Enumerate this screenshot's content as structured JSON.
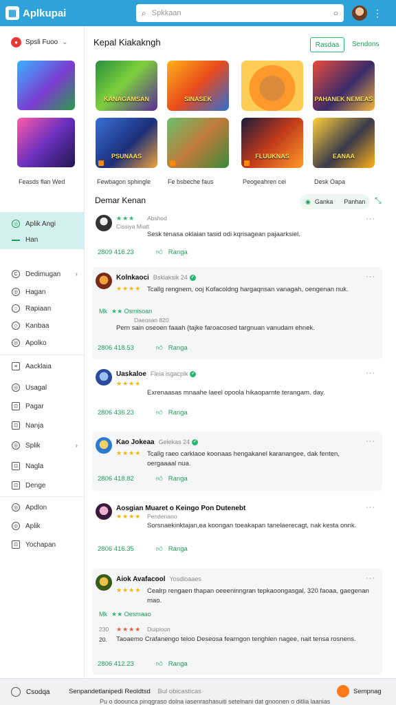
{
  "header": {
    "app_name": "Aplkupai",
    "search_placeholder": "Spkkaan"
  },
  "sidebar": {
    "profile_label": "Spsli Fuoo",
    "caption": "Feasds flan Wed",
    "active_title": "Aplik Angi",
    "active_sub": "Han",
    "items": [
      {
        "label": "Dedimugan",
        "icon": "C",
        "chevron": "›"
      },
      {
        "label": "Hagan",
        "icon": "◎"
      },
      {
        "label": "Rapiaan",
        "icon": "○"
      },
      {
        "label": "Kanbaa",
        "icon": "◇"
      },
      {
        "label": "Apolko",
        "icon": "◎"
      },
      {
        "label": "Aacklaia",
        "icon": "≡"
      },
      {
        "label": "Usagal",
        "icon": "◎"
      },
      {
        "label": "Pagar",
        "icon": "⊡"
      },
      {
        "label": "Nanja",
        "icon": "⊡"
      },
      {
        "label": "Splik",
        "icon": "◎",
        "chevron": "›"
      },
      {
        "label": "Nagla",
        "icon": "⊡"
      },
      {
        "label": "Denge",
        "icon": "⊡"
      },
      {
        "label": "Apdlon",
        "icon": "◎"
      },
      {
        "label": "Aplik",
        "icon": "◎"
      },
      {
        "label": "Yochapan",
        "icon": "⊡"
      }
    ]
  },
  "main": {
    "section_title": "Kepal Kiakakngh",
    "btn_primary": "Rasdaa",
    "btn_link": "Sendons",
    "games_row1": [
      {
        "title": "KANAGAMSAN"
      },
      {
        "title": "SINASEK"
      },
      {
        "title": ""
      },
      {
        "title": "PAHANEK NEMEAS"
      }
    ],
    "games_row2": [
      {
        "title": "PSUNAAS"
      },
      {
        "title": ""
      },
      {
        "title": "FLUUKNAS"
      },
      {
        "title": "EANAA"
      }
    ],
    "captions": [
      "Fewbagon sphingle",
      "Fe bsbeche faus",
      "Peogeahren cei",
      "Desk Oapa"
    ],
    "reviews_title": "Demar Kenan",
    "filter_chip": {
      "a": "Ganka",
      "b": "Panhan"
    }
  },
  "reviews": [
    {
      "name": "",
      "date": "Abshod",
      "subline": "Cissiya Miatt",
      "stars": "★★★",
      "text": "Sesk tenasa oklaian tasid odi kqrisagean pajaarksiel.",
      "count": "2809 416.23",
      "like": "Ranga"
    },
    {
      "name": "Kolnkaoci",
      "date": "Bsklaksik 24",
      "stars": "★★★★",
      "text": "Tcallg rengnem, ooj Kofacoldng hargaqnsan vanagah, oengenan nuk.",
      "mini_label": "Mk",
      "mini_name": "Osmisoan",
      "mini_stars": "★★",
      "sub": "Daeosan 820",
      "text2": "Pern sain oseoen faaah (tajke faroacosed targnuan vanudam ehnek.",
      "count": "2806 418.53",
      "like": "Ranga"
    },
    {
      "name": "Uaskaloe",
      "date": "Fleia isgacplk",
      "stars": "★★★★",
      "text": "Exrenaasas mnaahe laeel opoola hikaoparnte terangam. day.",
      "count": "2806 436.23",
      "like": "Ranga"
    },
    {
      "name": "Kao Jokeaa",
      "date": "Gelekas 24",
      "stars": "★★★★",
      "text": "Tcallg raeo carklaoe koonaas hengakanel karanangee, dak fenten, oergaaaal nua.",
      "count": "2806 418.82",
      "like": "Ranga"
    },
    {
      "name": "Aosgian Muaret o Keingo Pon Dutenebt",
      "date": "",
      "stars": "★★★★",
      "sub": "Pendenano",
      "text": "Sorsnaekinktajan,ea koongan toeakapan tanelaerecagt, nak kesta onnk.",
      "count": "2806 416.35",
      "like": "Ranga"
    },
    {
      "name": "Aiok Avafacool",
      "date": "Yosdloaaes",
      "stars": "★★★★",
      "text": "Cealrp rengaen thapan oeeeninngran tepkaoongasgal, 320 faoaa, gaegenan mao.",
      "mini_label": "Mk",
      "mini_name": "Oesmaao",
      "mini_stars": "★★",
      "extra_lead": "230",
      "extra_stars": "★★★★",
      "extra_sub": "Duipioon",
      "extra_lead2": "20.",
      "text2": "Taoaemo Crafanengo teloo Deseosa fearngon tenghlen nagee, nait tensa rosnens.",
      "count": "2806 412.23",
      "like": "Ranga"
    }
  ],
  "bottombar": {
    "left": "Csodqa",
    "mid": "Senpandetlanipedi Reoldtsd",
    "mid_muted": "Bul obicasticas",
    "right": "Sempnag",
    "line2": "Pu o doounca pinqgraso dolna iasenrashasuiti setelnani dat gnoonen o ditlia laanias"
  },
  "colors": {
    "header": "#2fa3d8",
    "accent_green": "#1f9b5c",
    "active_bg": "#d4f0ee",
    "star": "#f5b400"
  }
}
